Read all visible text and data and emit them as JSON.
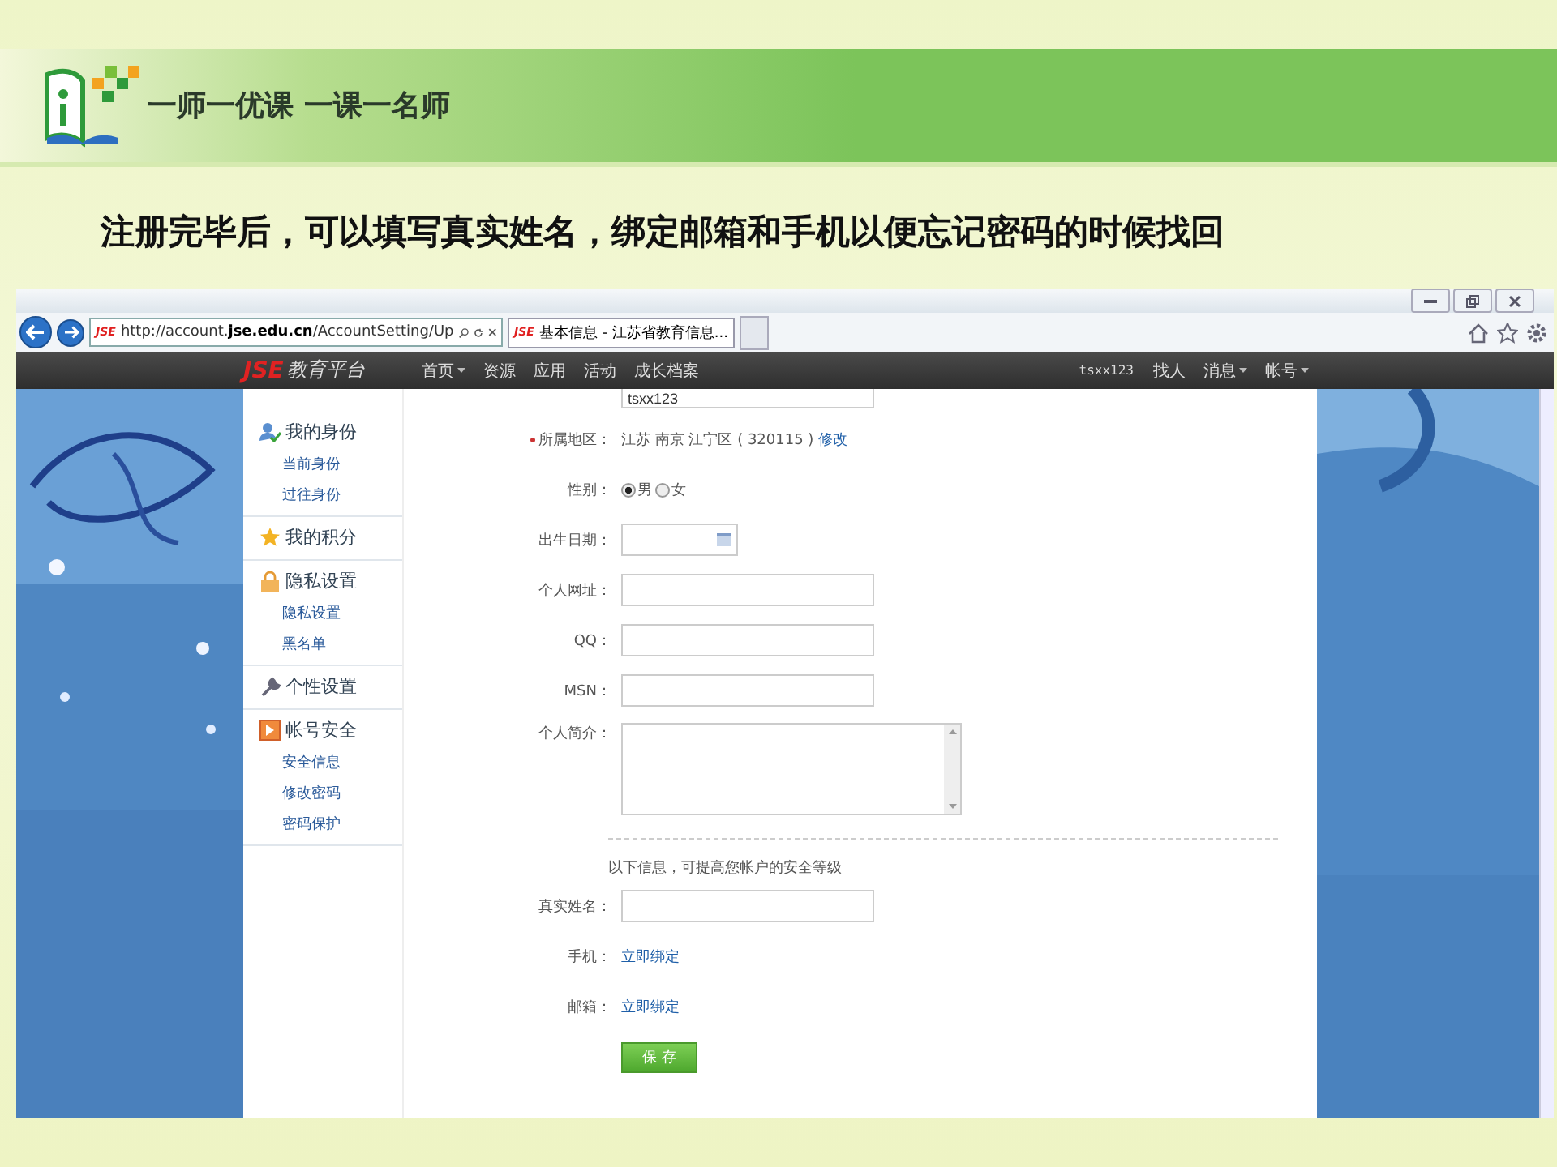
{
  "slide": {
    "slogan": "一师一优课 一课一名师",
    "title": "注册完毕后，可以填写真实姓名，绑定邮箱和手机以便忘记密码的时候找回"
  },
  "browser": {
    "address": {
      "favicon": "JSE",
      "url_prefix": "http://account.",
      "url_domain": "jse.edu.cn",
      "url_rest": "/AccountSetting/Up"
    },
    "tabs": [
      {
        "favicon": "JSE",
        "title": "基本信息 - 江苏省教育信息...",
        "selected": true
      }
    ]
  },
  "site_nav": {
    "logo_mark": "JSE",
    "logo_text": "教育平台",
    "items": [
      {
        "label": "首页",
        "dropdown": true
      },
      {
        "label": "资源",
        "dropdown": false
      },
      {
        "label": "应用",
        "dropdown": false
      },
      {
        "label": "活动",
        "dropdown": false
      },
      {
        "label": "成长档案",
        "dropdown": false
      }
    ],
    "user": "tsxx123",
    "right_items": [
      {
        "label": "找人",
        "dropdown": false
      },
      {
        "label": "消息",
        "dropdown": true
      },
      {
        "label": "帐号",
        "dropdown": true
      }
    ]
  },
  "sidebar": [
    {
      "label": "我的身份",
      "children": [
        {
          "label": "当前身份"
        },
        {
          "label": "过往身份"
        }
      ]
    },
    {
      "label": "我的积分"
    },
    {
      "label": "隐私设置",
      "children": [
        {
          "label": "隐私设置"
        },
        {
          "label": "黑名单"
        }
      ]
    },
    {
      "label": "个性设置"
    },
    {
      "label": "帐号安全",
      "children": [
        {
          "label": "安全信息"
        },
        {
          "label": "修改密码"
        },
        {
          "label": "密码保护"
        }
      ]
    }
  ],
  "form": {
    "rows": [
      {
        "kind": "input",
        "value": "tsxx123"
      },
      {
        "kind": "region",
        "label": "所属地区：",
        "required": true,
        "value": "江苏 南京 江宁区 ( 320115 )",
        "link": "修改"
      },
      {
        "kind": "radio",
        "label": "性别：",
        "options": [
          {
            "label": "男",
            "selected": true
          },
          {
            "label": "女",
            "selected": false
          }
        ]
      },
      {
        "kind": "date",
        "label": "出生日期："
      },
      {
        "kind": "input",
        "label": "个人网址："
      },
      {
        "kind": "input",
        "label": "QQ："
      },
      {
        "kind": "input",
        "label": "MSN："
      },
      {
        "kind": "textarea",
        "label": "个人简介："
      },
      {
        "kind": "divider"
      },
      {
        "kind": "note",
        "text": "以下信息，可提高您帐户的安全等级"
      },
      {
        "kind": "input",
        "label": "真实姓名："
      },
      {
        "kind": "link",
        "label": "手机：",
        "link": "立即绑定"
      },
      {
        "kind": "link",
        "label": "邮箱：",
        "link": "立即绑定"
      },
      {
        "kind": "button",
        "label": "保 存"
      }
    ]
  }
}
